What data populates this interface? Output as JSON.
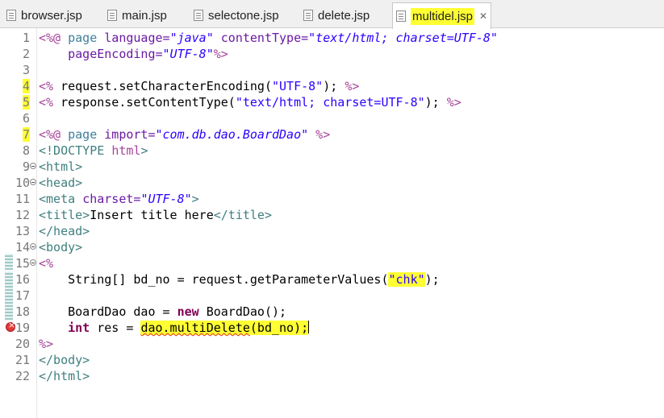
{
  "tabs": [
    {
      "label": "browser.jsp"
    },
    {
      "label": "main.jsp"
    },
    {
      "label": "selectone.jsp"
    },
    {
      "label": "delete.jsp"
    },
    {
      "label": "multidel.jsp",
      "active": true,
      "close": "✕"
    }
  ],
  "lines": [
    {
      "n": "1"
    },
    {
      "n": "2"
    },
    {
      "n": "3"
    },
    {
      "n": "4"
    },
    {
      "n": "5"
    },
    {
      "n": "6"
    },
    {
      "n": "7"
    },
    {
      "n": "8"
    },
    {
      "n": "9"
    },
    {
      "n": "10"
    },
    {
      "n": "11"
    },
    {
      "n": "12"
    },
    {
      "n": "13"
    },
    {
      "n": "14"
    },
    {
      "n": "15"
    },
    {
      "n": "16"
    },
    {
      "n": "17"
    },
    {
      "n": "18"
    },
    {
      "n": "19"
    },
    {
      "n": "20"
    },
    {
      "n": "21"
    },
    {
      "n": "22"
    }
  ],
  "code": {
    "l1_a": "<%@",
    "l1_b": " page ",
    "l1_c": "language=",
    "l1_d": "\"java\"",
    "l1_e": " contentType=",
    "l1_f": "\"text/html; charset=UTF-8\"",
    "l2_a": "    pageEncoding=",
    "l2_b": "\"UTF-8\"",
    "l2_c": "%>",
    "l4_a": "<%",
    "l4_b": " request.setCharacterEncoding(",
    "l4_c": "\"UTF-8\"",
    "l4_d": "); ",
    "l4_e": "%>",
    "l5_a": "<%",
    "l5_b": " response.setContentType(",
    "l5_c": "\"text/html; charset=UTF-8\"",
    "l5_d": "); ",
    "l5_e": "%>",
    "l7_a": "<%@",
    "l7_b": " page ",
    "l7_c": "import=",
    "l7_d": "\"com.db.dao.BoardDao\"",
    "l7_e": " %>",
    "l8_a": "<!DOCTYPE ",
    "l8_b": "html",
    "l8_c": ">",
    "l9": "<html>",
    "l10": "<head>",
    "l11_a": "<meta ",
    "l11_b": "charset=",
    "l11_c": "\"UTF-8\"",
    "l11_d": ">",
    "l12_a": "<title>",
    "l12_b": "Insert title here",
    "l12_c": "</title>",
    "l13": "</head>",
    "l14": "<body>",
    "l15": "<%",
    "l16_a": "    String[] bd_no = request.getParameterValues(",
    "l16_b": "\"chk\"",
    "l16_c": ");",
    "l18_a": "    BoardDao dao = ",
    "l18_b": "new",
    "l18_c": " BoardDao();",
    "l19_a": "    ",
    "l19_b": "int",
    "l19_c": " res = ",
    "l19_d": "dao.multiDelete",
    "l19_e": "(bd_no);",
    "l20": "%>",
    "l21": "</body>",
    "l22": "</html>"
  }
}
